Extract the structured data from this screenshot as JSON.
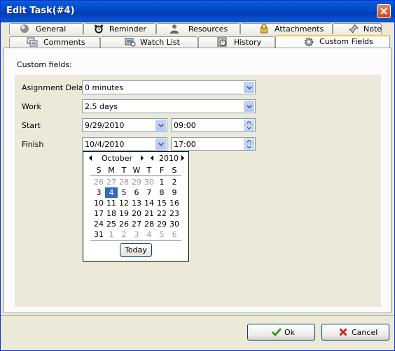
{
  "window": {
    "title": "Edit Task(#4)"
  },
  "tabs_row1": [
    {
      "label": "General",
      "icon": "general-icon"
    },
    {
      "label": "Reminder",
      "icon": "alarm-clock-icon"
    },
    {
      "label": "Resources",
      "icon": "person-icon"
    },
    {
      "label": "Attachments",
      "icon": "lock-icon"
    },
    {
      "label": "Note",
      "icon": "pushpin-icon"
    }
  ],
  "tabs_row2": [
    {
      "label": "Comments",
      "icon": "comments-icon"
    },
    {
      "label": "Watch List",
      "icon": "watch-list-icon"
    },
    {
      "label": "History",
      "icon": "history-icon"
    },
    {
      "label": "Custom Fields",
      "icon": "gear-icon",
      "active": true
    }
  ],
  "custom_fields": {
    "section_label": "Custom fields:",
    "assignment_delay": {
      "label": "Asignment Delay",
      "value": "0 minutes"
    },
    "work": {
      "label": "Work",
      "value": "2.5 days"
    },
    "start": {
      "label": "Start",
      "date": "9/29/2010",
      "time": "09:00"
    },
    "finish": {
      "label": "Finish",
      "date": "10/4/2010",
      "time": "17:00"
    }
  },
  "calendar": {
    "month": "October",
    "year": "2010",
    "weekdays": [
      "S",
      "M",
      "T",
      "W",
      "T",
      "F",
      "S"
    ],
    "weeks": [
      [
        "26",
        "27",
        "28",
        "29",
        "30",
        "1",
        "2"
      ],
      [
        "3",
        "4",
        "5",
        "6",
        "7",
        "8",
        "9"
      ],
      [
        "10",
        "11",
        "12",
        "13",
        "14",
        "15",
        "16"
      ],
      [
        "17",
        "18",
        "19",
        "20",
        "21",
        "22",
        "23"
      ],
      [
        "24",
        "25",
        "26",
        "27",
        "28",
        "29",
        "30"
      ],
      [
        "31",
        "1",
        "2",
        "3",
        "4",
        "5",
        "6"
      ]
    ],
    "other_month_mask": [
      [
        true,
        true,
        true,
        true,
        true,
        false,
        false
      ],
      [
        false,
        false,
        false,
        false,
        false,
        false,
        false
      ],
      [
        false,
        false,
        false,
        false,
        false,
        false,
        false
      ],
      [
        false,
        false,
        false,
        false,
        false,
        false,
        false
      ],
      [
        false,
        false,
        false,
        false,
        false,
        false,
        false
      ],
      [
        false,
        true,
        true,
        true,
        true,
        true,
        true
      ]
    ],
    "selected_day": "4",
    "today_label": "Today"
  },
  "footer": {
    "ok_label": "Ok",
    "cancel_label": "Cancel"
  },
  "colors": {
    "title_bar": "#0054e3",
    "selection": "#316ac5",
    "tab_highlight": "#ffc83c",
    "close": "#c7451d"
  }
}
